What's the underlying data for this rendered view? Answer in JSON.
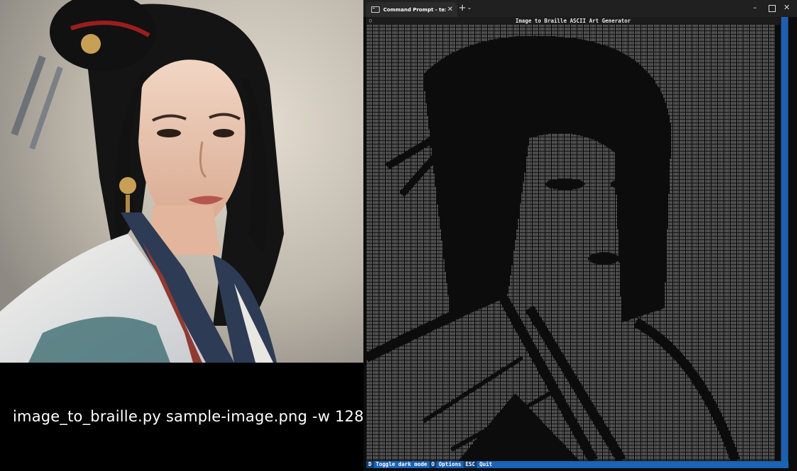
{
  "caption": "image_to_braille.py sample-image.png -w 128",
  "terminal": {
    "tab_title": "Command Prompt - textual r",
    "tab_close": "✕",
    "new_tab": "+",
    "tab_dropdown": "⌄",
    "minimize": "–",
    "close": "✕"
  },
  "app": {
    "indicator": "○",
    "title": "Image to Braille ASCII Art Generator"
  },
  "footer": {
    "items": [
      {
        "key": "D",
        "label": "Toggle dark mode"
      },
      {
        "key": "O",
        "label": "Options"
      },
      {
        "key": "ESC",
        "label": "Quit"
      }
    ]
  },
  "colors": {
    "terminal_bg": "#0c0c0c",
    "art_fg": "#8a8a8a",
    "footer_bg": "#1a63b5",
    "scrollbar": "#1f5fae"
  },
  "icons": {
    "tab": "terminal-icon",
    "maximize": "maximize-icon"
  }
}
